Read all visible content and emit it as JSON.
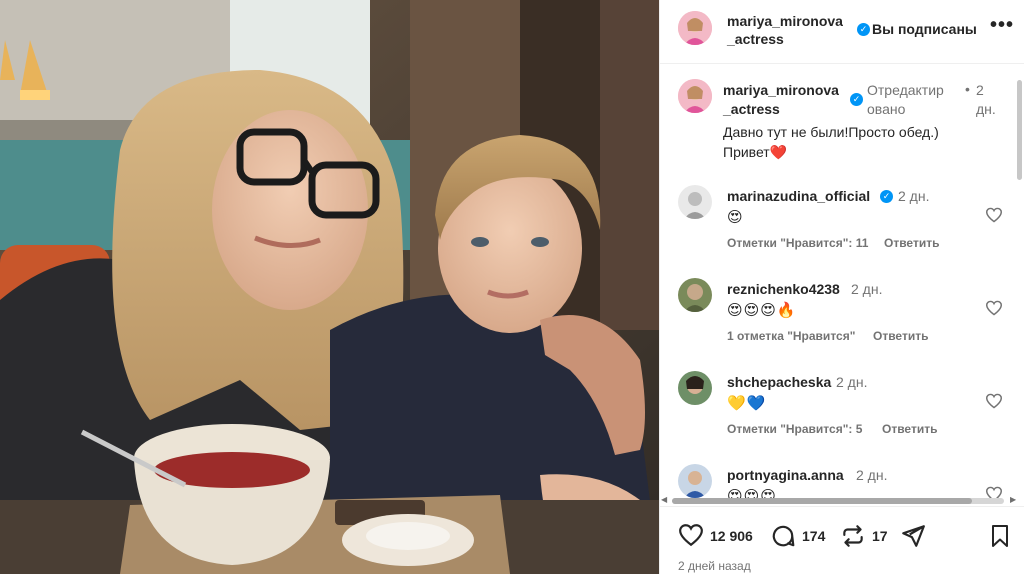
{
  "post": {
    "username": "mariya_mironova _actress",
    "follow_label": "Вы подписаны",
    "more_label": "•••"
  },
  "caption": {
    "username": "mariya_mironova _actress",
    "edited": "Отредактир овано",
    "dot": "•",
    "time": "2 дн.",
    "text": "Давно тут не были!Просто обед.) Привет❤️"
  },
  "comments": [
    {
      "user": "marinazudina_official",
      "verified": true,
      "time": "2 дн.",
      "text": "😍",
      "likes": "Отметки \"Нравится\": 11",
      "reply": "Ответить"
    },
    {
      "user": "reznichenko4238",
      "verified": false,
      "time": "2 дн.",
      "text": "😍😍😍🔥",
      "likes": "1 отметка \"Нравится\"",
      "reply": "Ответить"
    },
    {
      "user": "shchepacheska",
      "verified": false,
      "time": "2 дн.",
      "text": "💛💙",
      "likes": "Отметки \"Нравится\": 5",
      "reply": "Ответить"
    },
    {
      "user": "portnyagina.anna",
      "verified": false,
      "time": "2 дн.",
      "text": "😍😍😍",
      "likes": "",
      "reply": ""
    }
  ],
  "actions": {
    "likes_count": "12 906",
    "comments_count": "174",
    "reposts_count": "17"
  },
  "posted": "2 дней назад",
  "icons": [
    "more-icon",
    "verified-icon",
    "heart-icon",
    "comment-icon",
    "repost-icon",
    "share-icon",
    "bookmark-icon"
  ]
}
